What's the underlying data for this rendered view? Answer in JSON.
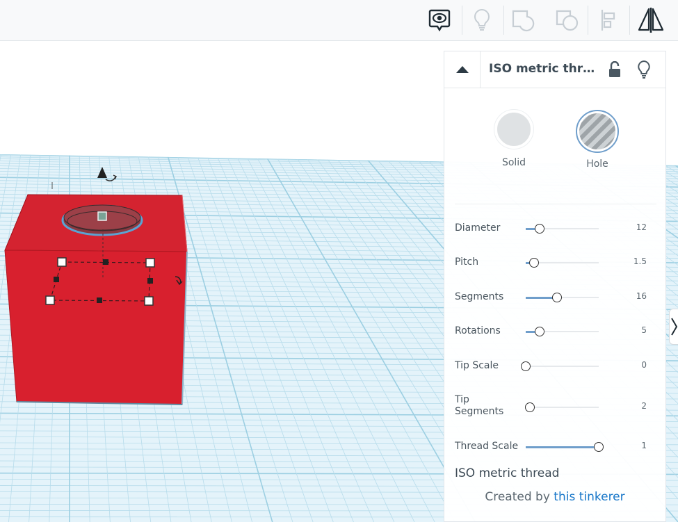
{
  "toolbar": {
    "buttons": [
      {
        "name": "show-hide",
        "icon": "speech-bubble-eye-icon",
        "active": true
      },
      {
        "name": "notes",
        "icon": "light-bulb-icon",
        "active": false
      },
      {
        "name": "group",
        "icon": "group-shapes-icon",
        "active": false
      },
      {
        "name": "ungroup",
        "icon": "ungroup-shapes-icon",
        "active": false
      },
      {
        "name": "align",
        "icon": "align-icon",
        "active": false
      },
      {
        "name": "mirror",
        "icon": "mirror-icon",
        "active": true
      }
    ]
  },
  "inspector": {
    "title": "ISO metric thre...",
    "collapse_icon": "triangle-up-icon",
    "lock_icon": "unlocked-padlock-icon",
    "light_icon": "light-bulb-icon",
    "solid_label": "Solid",
    "hole_label": "Hole",
    "params": [
      {
        "label": "Diameter",
        "value": "12",
        "level": 0.19
      },
      {
        "label": "Pitch",
        "value": "1.5",
        "level": 0.11
      },
      {
        "label": "Segments",
        "value": "16",
        "level": 0.43
      },
      {
        "label": "Rotations",
        "value": "5",
        "level": 0.19
      },
      {
        "label": "Tip Scale",
        "value": "0",
        "level": 0.0
      },
      {
        "label": "Tip\nSegments",
        "value": "2",
        "level": 0.06
      },
      {
        "label": "Thread Scale",
        "value": "1",
        "level": 1.0
      }
    ],
    "shape_name": "ISO metric thread",
    "credit_prefix": "Created by ",
    "credit_link": "this tinkerer"
  },
  "colors": {
    "accent": "#6f9ecb",
    "box_red": "#d8202e",
    "grid": "#b7dceb",
    "workplane": "#e4f3fa"
  }
}
